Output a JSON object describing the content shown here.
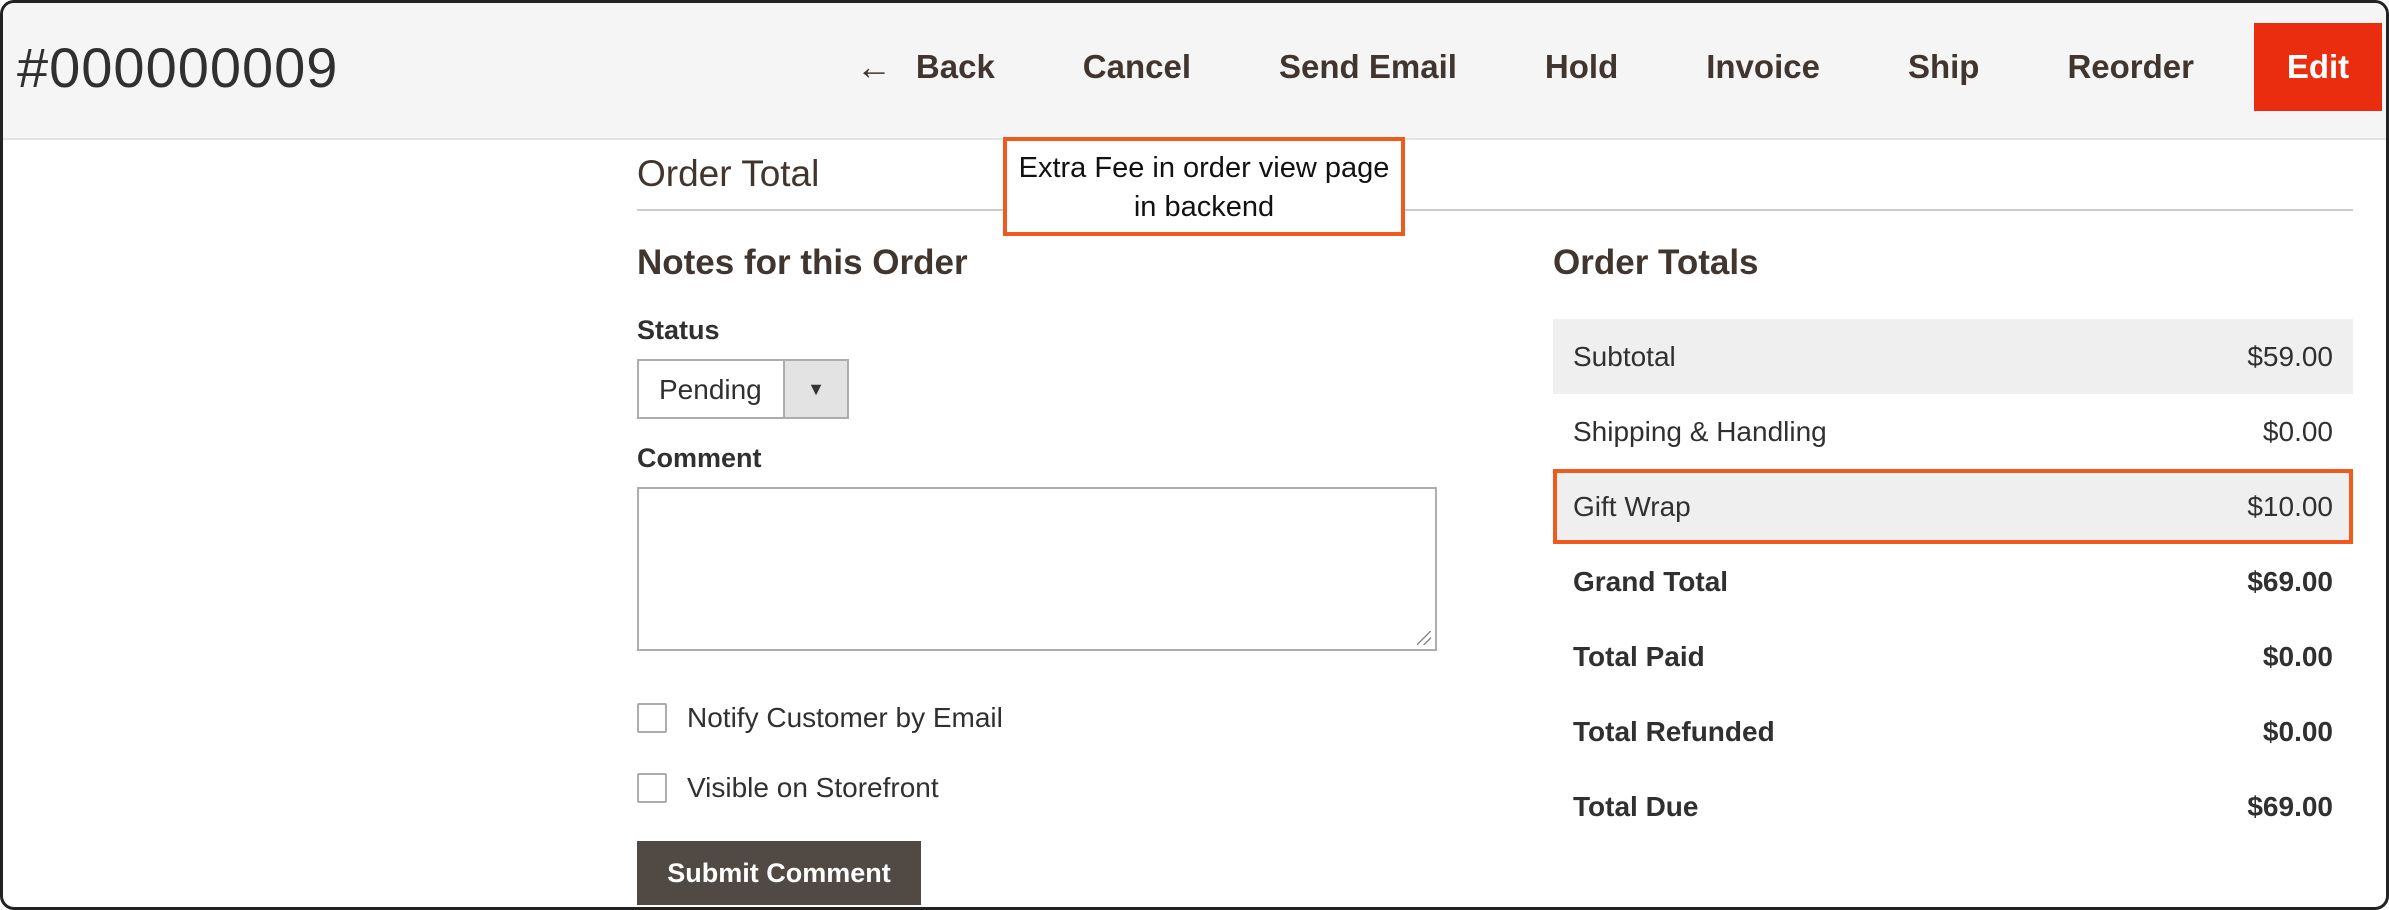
{
  "header": {
    "order_id": "#000000009",
    "actions": {
      "back": "Back",
      "cancel": "Cancel",
      "send_email": "Send Email",
      "hold": "Hold",
      "invoice": "Invoice",
      "ship": "Ship",
      "reorder": "Reorder",
      "edit": "Edit"
    },
    "colors": {
      "edit_bg": "#eb2d0f",
      "header_bg": "#f5f5f5"
    }
  },
  "section": {
    "title": "Order Total"
  },
  "callout": {
    "line1": "Extra Fee in order view page",
    "line2": "in backend",
    "border_color": "#f05a1e"
  },
  "notes": {
    "title": "Notes for this Order",
    "status_label": "Status",
    "status_value": "Pending",
    "comment_label": "Comment",
    "comment_value": "",
    "notify_label": "Notify Customer by Email",
    "notify_checked": false,
    "visible_label": "Visible on Storefront",
    "visible_checked": false,
    "submit_label": "Submit Comment"
  },
  "totals": {
    "title": "Order Totals",
    "rows": [
      {
        "label": "Subtotal",
        "value": "$59.00"
      },
      {
        "label": "Shipping & Handling",
        "value": "$0.00"
      },
      {
        "label": "Gift Wrap",
        "value": "$10.00"
      },
      {
        "label": "Grand Total",
        "value": "$69.00"
      },
      {
        "label": "Total Paid",
        "value": "$0.00"
      },
      {
        "label": "Total Refunded",
        "value": "$0.00"
      },
      {
        "label": "Total Due",
        "value": "$69.00"
      }
    ]
  }
}
